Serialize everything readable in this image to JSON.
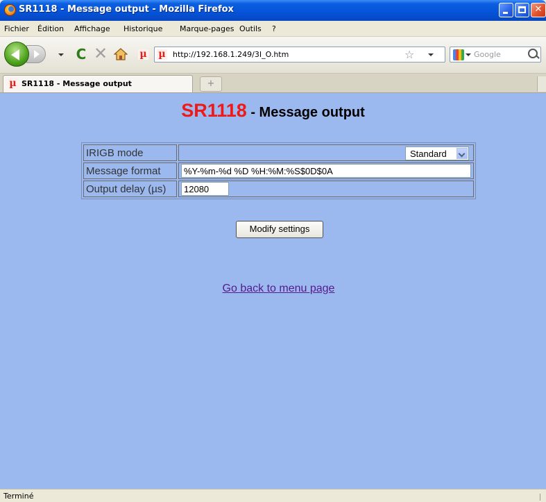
{
  "window": {
    "title": "SR1118 - Message output - Mozilla Firefox"
  },
  "menu": {
    "items": [
      "Fichier",
      "Édition",
      "Affichage",
      "Historique",
      "Marque-pages",
      "Outils",
      "?"
    ]
  },
  "nav": {
    "url": "http://192.168.1.249/3I_O.htm",
    "search_placeholder": "Google"
  },
  "tab": {
    "label": "SR1118 - Message output",
    "new_tab_symbol": "+"
  },
  "page": {
    "heading_brand": "SR1118",
    "heading_rest": " - Message output",
    "rows": [
      {
        "label": "IRIGB mode",
        "value": "Standard"
      },
      {
        "label": "Message format",
        "value": "%Y-%m-%d %D %H:%M:%S$0D$0A"
      },
      {
        "label": "Output delay (µs)",
        "value": "12080"
      }
    ],
    "modify_button": "Modify settings",
    "back_link": "Go back to menu page"
  },
  "status": {
    "text": "Terminé"
  },
  "icons": {
    "app": "firefox-icon",
    "favicon": "µ",
    "reload": "C",
    "stop": "✕",
    "bookmark_star": "☆"
  }
}
